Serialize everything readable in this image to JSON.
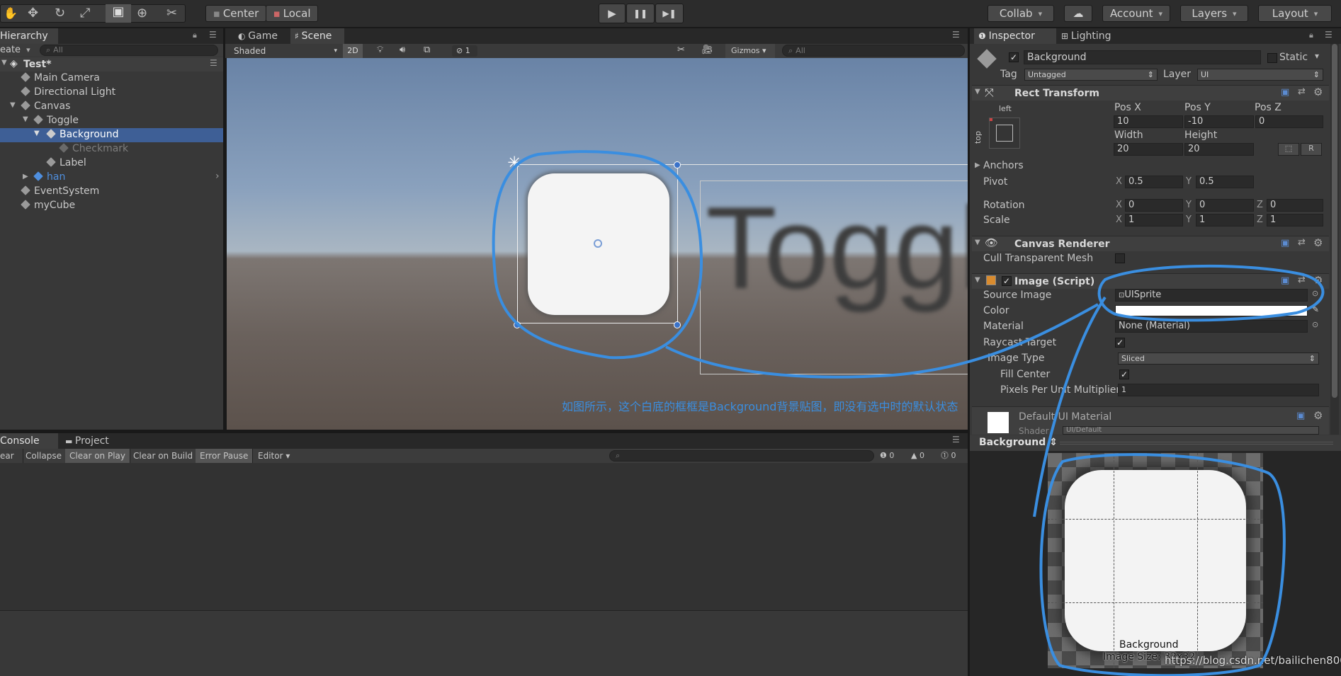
{
  "toolbar": {
    "pivot": "Center",
    "space": "Local",
    "collab": "Collab",
    "account": "Account",
    "layers": "Layers",
    "layout": "Layout",
    "play": "▶",
    "pause": "❚❚",
    "step": "▶❚"
  },
  "hierarchy": {
    "tab": "Hierarchy",
    "create": "eate",
    "search_placeholder": "All",
    "scene": "Test*",
    "items": [
      "Main Camera",
      "Directional Light",
      "Canvas",
      "Toggle",
      "Background",
      "Checkmark",
      "Label",
      "han",
      "EventSystem",
      "myCube"
    ]
  },
  "scene_view": {
    "tab_game": "Game",
    "tab_scene": "Scene",
    "shading": "Shaded",
    "mode2d": "2D",
    "hidden_count": "1",
    "gizmos": "Gizmos",
    "search_placeholder": "All",
    "toggle_label": "Toggl",
    "annotation": "如图所示，这个白底的框框是Background背景贴图，即没有选中时的默认状态"
  },
  "console": {
    "tab_console": "Console",
    "tab_project": "Project",
    "clear": "ear",
    "collapse": "Collapse",
    "clear_on_play": "Clear on Play",
    "clear_on_build": "Clear on Build",
    "error_pause": "Error Pause",
    "editor": "Editor",
    "count_log": "0",
    "count_warn": "0",
    "count_error": "0"
  },
  "inspector": {
    "tab_inspector": "Inspector",
    "tab_lighting": "Lighting",
    "object_name": "Background",
    "static": "Static",
    "tag_label": "Tag",
    "tag_value": "Untagged",
    "layer_label": "Layer",
    "layer_value": "UI",
    "rect": {
      "title": "Rect Transform",
      "anchor_h": "left",
      "anchor_v": "top",
      "posx_label": "Pos X",
      "posy_label": "Pos Y",
      "posz_label": "Pos Z",
      "posx": "10",
      "posy": "-10",
      "posz": "0",
      "width_label": "Width",
      "height_label": "Height",
      "width": "20",
      "height": "20",
      "r_btn": "R",
      "anchors": "Anchors",
      "pivot": "Pivot",
      "pivot_x": "0.5",
      "pivot_y": "0.5",
      "rotation": "Rotation",
      "rot_x": "0",
      "rot_y": "0",
      "rot_z": "0",
      "scale": "Scale",
      "scale_x": "1",
      "scale_y": "1",
      "scale_z": "1",
      "x": "X",
      "y": "Y",
      "z": "Z"
    },
    "canvas_renderer": {
      "title": "Canvas Renderer",
      "cull": "Cull Transparent Mesh"
    },
    "image": {
      "title": "Image (Script)",
      "source_image": "Source Image",
      "source_value": "UISprite",
      "color": "Color",
      "material": "Material",
      "material_value": "None (Material)",
      "raycast": "Raycast Target",
      "image_type": "Image Type",
      "image_type_value": "Sliced",
      "fill_center": "Fill Center",
      "ppu": "Pixels Per Unit Multiplier",
      "ppu_value": "1"
    },
    "default_material": "Default UI Material",
    "shader_label": "Shader",
    "shader_value": "UI/Default"
  },
  "preview": {
    "title": "Background",
    "name": "Background",
    "size": "Image Size: 32x32",
    "watermark": "https://blog.csdn.net/bailichen800"
  },
  "colors": {
    "annotation": "#3a8ee0",
    "selection": "#3e5f96"
  }
}
